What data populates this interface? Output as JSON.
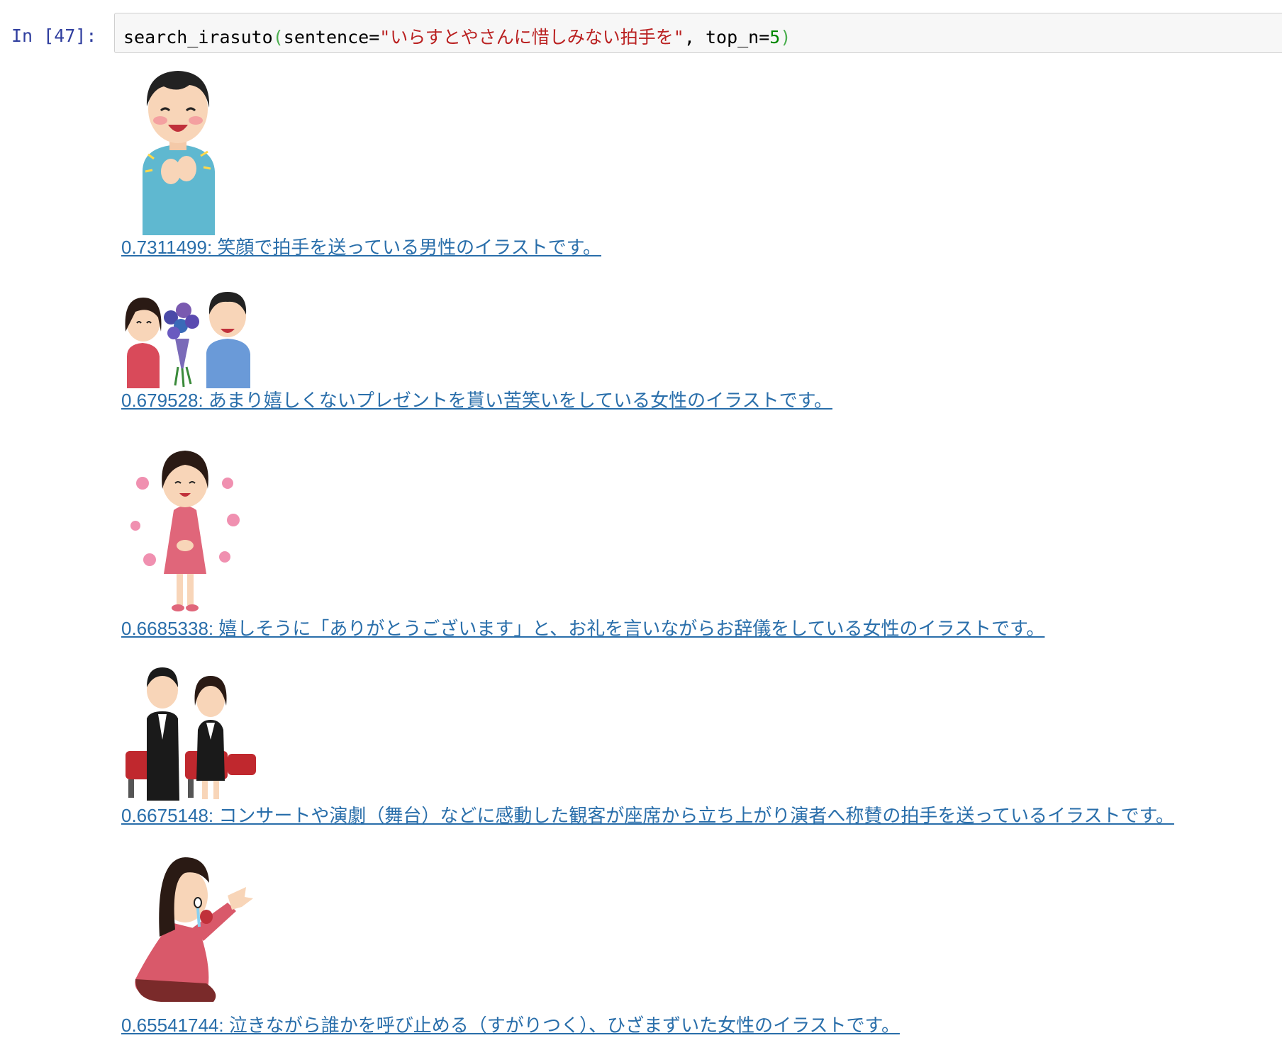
{
  "cell": {
    "prompt": "In [47]:",
    "code": {
      "func": "search_irasuto",
      "open_paren": "(",
      "arg1_name": "sentence=",
      "arg1_value": "\"いらすとやさんに惜しみない拍手を\"",
      "sep": ", ",
      "arg2_name": "top_n=",
      "arg2_value": "5",
      "close_paren": ")"
    }
  },
  "results": [
    {
      "text": "0.7311499: 笑顔で拍手を送っている男性のイラストです。 ",
      "image_icon": "clapping-man-illustration"
    },
    {
      "text": "0.679528: あまり嬉しくないプレゼントを貰い苦笑いをしている女性のイラストです。 ",
      "image_icon": "woman-receiving-bouquet-illustration"
    },
    {
      "text": "0.6685338: 嬉しそうに「ありがとうございます」と、お礼を言いながらお辞儀をしている女性のイラストです。 ",
      "image_icon": "bowing-woman-with-flowers-illustration"
    },
    {
      "text": "0.6675148: コンサートや演劇（舞台）などに感動した観客が座席から立ち上がり演者へ称賛の拍手を送っているイラストです。 ",
      "image_icon": "standing-ovation-audience-illustration"
    },
    {
      "text": "0.65541744: 泣きながら誰かを呼び止める（すがりつく）、ひざまずいた女性のイラストです。 ",
      "image_icon": "kneeling-crying-woman-illustration"
    }
  ]
}
